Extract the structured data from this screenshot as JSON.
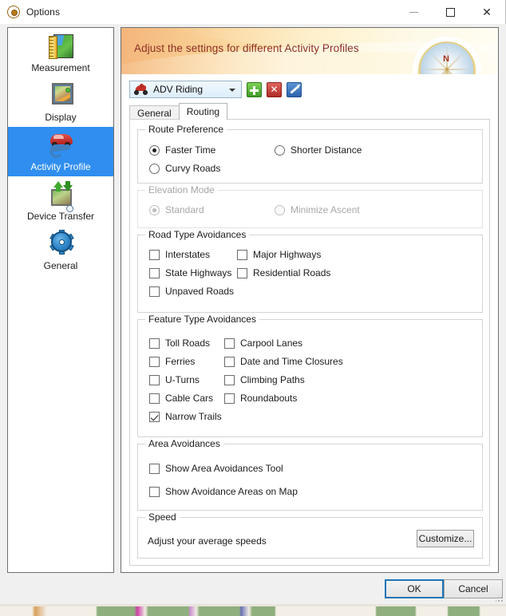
{
  "window": {
    "title": "Options",
    "app_icon": "compass-app-icon",
    "controls": {
      "minimize": "minimize-icon",
      "maximize": "maximize-icon",
      "close": "close-icon"
    }
  },
  "sidebar": {
    "items": [
      {
        "label": "Measurement",
        "icon": "ruler-map-icon",
        "selected": false
      },
      {
        "label": "Display",
        "icon": "map-frame-icon",
        "selected": false
      },
      {
        "label": "Activity Profile",
        "icon": "car-wrench-icon",
        "selected": true
      },
      {
        "label": "Device Transfer",
        "icon": "device-sync-icon",
        "selected": false
      },
      {
        "label": "General",
        "icon": "gear-icon",
        "selected": false
      }
    ],
    "selected_color": "#2f8ef0"
  },
  "header": {
    "banner_text": "Adjust the settings for different Activity Profiles",
    "banner_text_color": "#8d2f22",
    "decoration_icon": "compass-rose-icon",
    "compass_label": "N"
  },
  "profile_selector": {
    "icon": "motorcycle-icon",
    "value": "ADV Riding",
    "dropdown_icon": "chevron-down-icon",
    "buttons": [
      {
        "name": "add-profile-button",
        "icon": "plus-icon",
        "color": "#3f9a27"
      },
      {
        "name": "delete-profile-button",
        "icon": "x-icon",
        "color": "#b02b25",
        "glyph": "✕"
      },
      {
        "name": "edit-profile-button",
        "icon": "pencil-icon",
        "color": "#2c63ab"
      }
    ]
  },
  "tabs": [
    {
      "label": "General",
      "active": false
    },
    {
      "label": "Routing",
      "active": true
    }
  ],
  "route_preference": {
    "title": "Route Preference",
    "options": [
      {
        "label": "Faster Time",
        "checked": true
      },
      {
        "label": "Shorter Distance",
        "checked": false
      },
      {
        "label": "Curvy Roads",
        "checked": false
      }
    ]
  },
  "elevation_mode": {
    "title": "Elevation Mode",
    "disabled": true,
    "options": [
      {
        "label": "Standard",
        "checked": true
      },
      {
        "label": "Minimize Ascent",
        "checked": false
      }
    ]
  },
  "road_type_avoidances": {
    "title": "Road Type Avoidances",
    "options": [
      {
        "label": "Interstates",
        "checked": false
      },
      {
        "label": "Major Highways",
        "checked": false
      },
      {
        "label": "State Highways",
        "checked": false
      },
      {
        "label": "Residential Roads",
        "checked": false
      },
      {
        "label": "Unpaved Roads",
        "checked": false
      }
    ]
  },
  "feature_type_avoidances": {
    "title": "Feature Type Avoidances",
    "options": [
      {
        "label": "Toll Roads",
        "checked": false
      },
      {
        "label": "Carpool Lanes",
        "checked": false
      },
      {
        "label": "Ferries",
        "checked": false
      },
      {
        "label": "Date and Time Closures",
        "checked": false
      },
      {
        "label": "U-Turns",
        "checked": false
      },
      {
        "label": "Climbing Paths",
        "checked": false
      },
      {
        "label": "Cable Cars",
        "checked": false
      },
      {
        "label": "Roundabouts",
        "checked": false
      },
      {
        "label": "Narrow Trails",
        "checked": true
      }
    ]
  },
  "area_avoidances": {
    "title": "Area Avoidances",
    "options": [
      {
        "label": "Show Area Avoidances Tool",
        "checked": false
      },
      {
        "label": "Show Avoidance Areas on Map",
        "checked": false
      }
    ]
  },
  "speed": {
    "title": "Speed",
    "description": "Adjust your average speeds",
    "button_label": "Customize..."
  },
  "footer": {
    "ok_label": "OK",
    "cancel_label": "Cancel",
    "focused_button": "OK",
    "focus_color": "#1b74b5"
  }
}
